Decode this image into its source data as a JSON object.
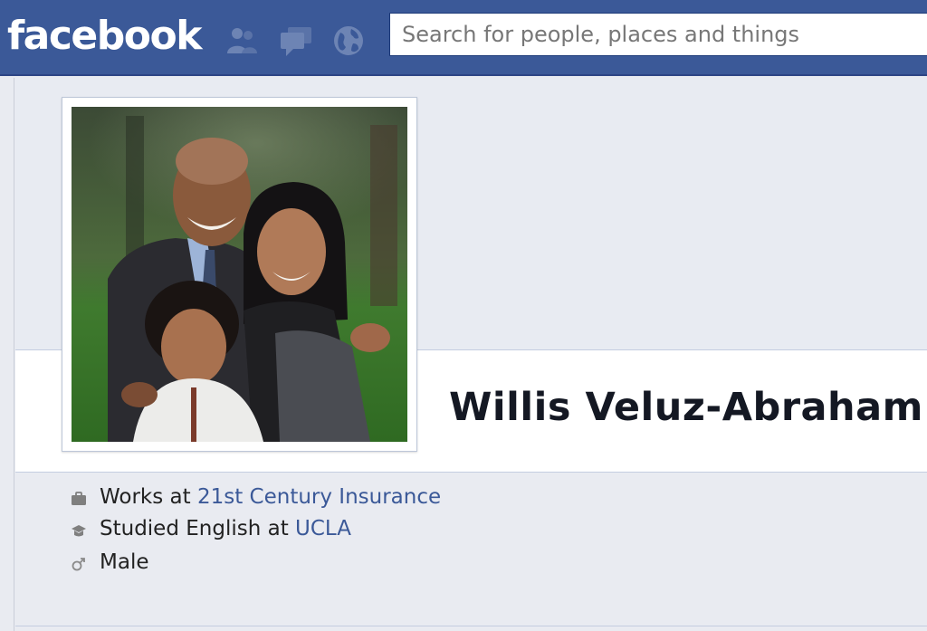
{
  "header": {
    "logo": "facebook",
    "search_placeholder": "Search for people, places and things",
    "icons": [
      "friend-requests-icon",
      "messages-icon",
      "notifications-globe-icon"
    ]
  },
  "profile": {
    "name": "Willis Veluz-Abraham",
    "photo_alt": "Profile picture"
  },
  "info": {
    "work": {
      "prefix": "Works at ",
      "link": "21st Century Insurance",
      "icon": "briefcase-icon"
    },
    "education": {
      "prefix": "Studied English at ",
      "link": "UCLA",
      "icon": "graduation-icon"
    },
    "gender": {
      "text": "Male",
      "icon": "male-symbol-icon"
    }
  },
  "colors": {
    "brand": "#3b5998",
    "link": "#3b5998",
    "background": "#e9ebf1"
  }
}
